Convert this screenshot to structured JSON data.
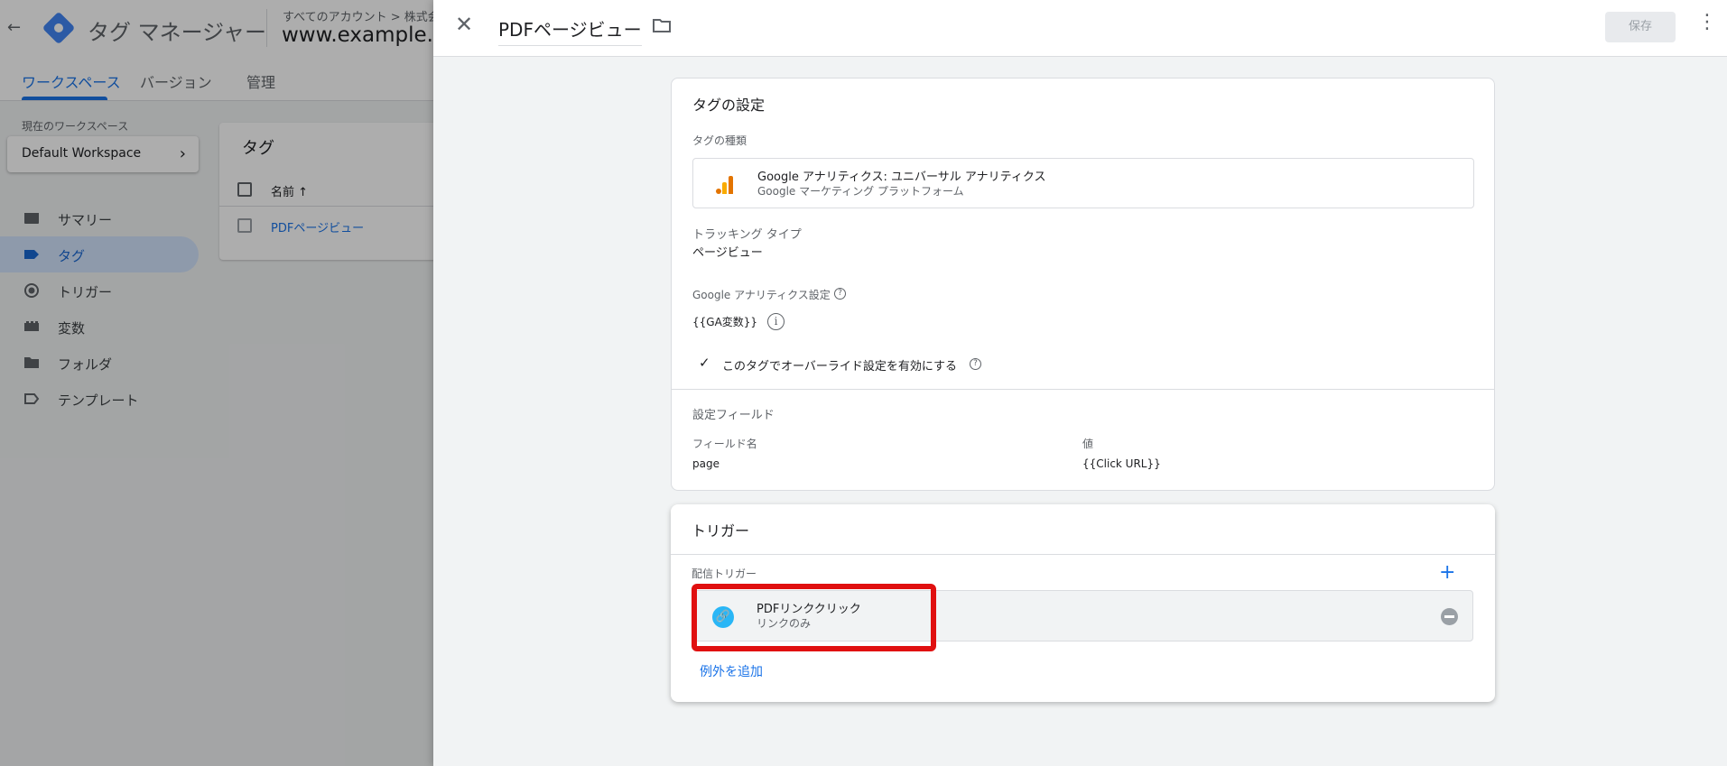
{
  "app": {
    "back_icon": "arrow-left-icon",
    "title": "タグ マネージャー",
    "account_crumb": "すべてのアカウント > 株式会",
    "container_name": "www.example.co"
  },
  "subnav": {
    "tabs": [
      "ワークスペース",
      "バージョン",
      "管理"
    ],
    "active_tab": "ワークスペース"
  },
  "workspace": {
    "label": "現在のワークスペース",
    "value": "Default Workspace"
  },
  "sidebar": {
    "items": [
      {
        "label": "サマリー",
        "icon": "summary-icon"
      },
      {
        "label": "タグ",
        "icon": "tag-icon",
        "active": true
      },
      {
        "label": "トリガー",
        "icon": "trigger-icon"
      },
      {
        "label": "変数",
        "icon": "variables-icon"
      },
      {
        "label": "フォルダ",
        "icon": "folder-icon"
      },
      {
        "label": "テンプレート",
        "icon": "template-icon"
      }
    ]
  },
  "tags_list": {
    "title": "タグ",
    "column_name": "名前 ↑",
    "rows": [
      "PDFページビュー"
    ]
  },
  "panel": {
    "title": "PDFページビュー",
    "save_label": "保存",
    "tag_config": {
      "title": "タグの設定",
      "tag_type_label": "タグの種類",
      "tag_type_name": "Google アナリティクス: ユニバーサル アナリティクス",
      "tag_type_sub": "Google マーケティング プラットフォーム",
      "tracking_type_label": "トラッキング タイプ",
      "tracking_type_value": "ページビュー",
      "ga_settings_label": "Google アナリティクス設定",
      "ga_settings_value": "{{GA変数}}",
      "override_label": "このタグでオーバーライド設定を有効にする",
      "fields_section": "設定フィールド",
      "field_name_header": "フィールド名",
      "field_value_header": "値",
      "field_name": "page",
      "field_value": "{{Click URL}}"
    },
    "triggers": {
      "title": "トリガー",
      "firing_label": "配信トリガー",
      "trigger_name": "PDFリンククリック",
      "trigger_sub": "リンクのみ",
      "add_exception": "例外を追加"
    }
  },
  "colors": {
    "accent": "#1a73e8",
    "highlight": "#e01010",
    "ga_orange": "#f9ab00",
    "ga_dark_orange": "#e37400",
    "link_trigger_blue": "#29b6f6"
  }
}
